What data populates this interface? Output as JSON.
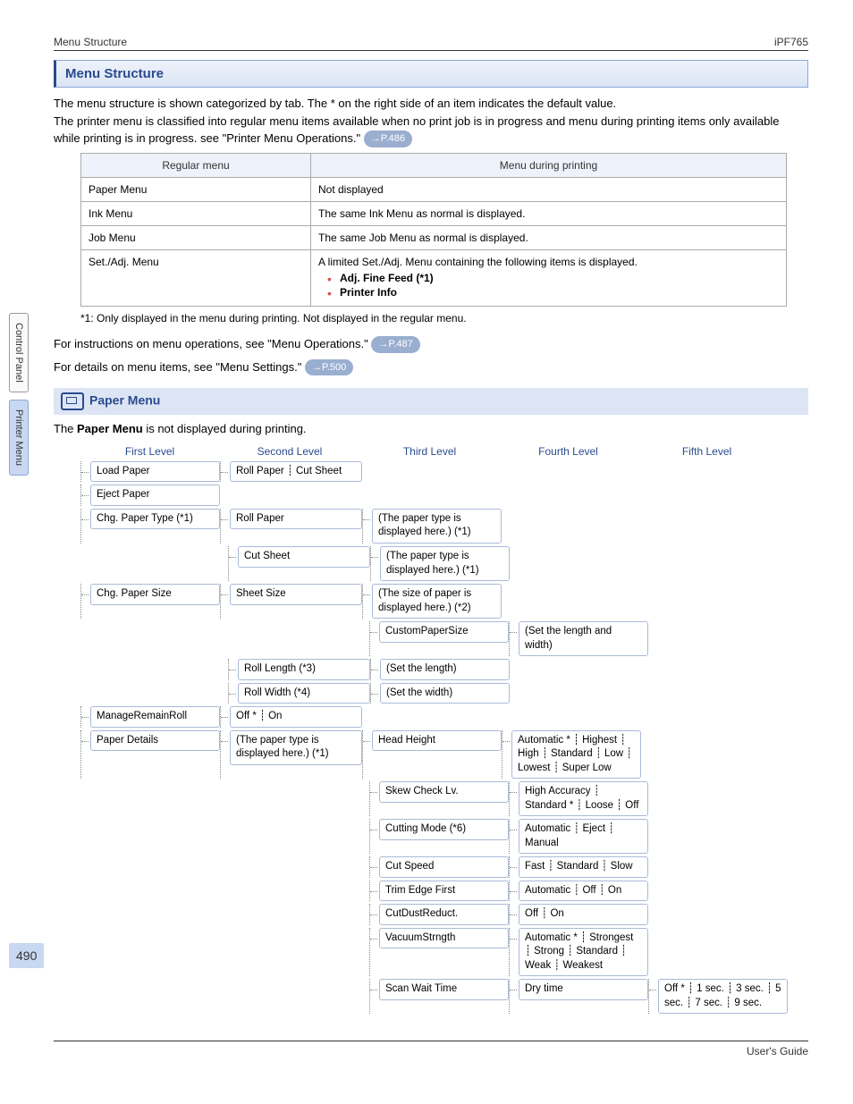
{
  "header": {
    "left": "Menu Structure",
    "right": "iPF765"
  },
  "sideTabs": {
    "tab1": "Control Panel",
    "tab2": "Printer Menu"
  },
  "pageNumber": "490",
  "section": {
    "title": "Menu Structure",
    "intro": "The menu structure is shown categorized by tab. The * on the right side of an item indicates the default value.\nThe printer menu is classified into regular menu items available when no print job is in progress and menu during printing items only available while printing is in progress. see \"Printer Menu Operations.\"",
    "introRef": "→P.486"
  },
  "table": {
    "th1": "Regular menu",
    "th2": "Menu during printing",
    "r1c1": "Paper Menu",
    "r1c2": "Not displayed",
    "r2c1": "Ink Menu",
    "r2c2": "The same Ink Menu as normal is displayed.",
    "r3c1": "Job Menu",
    "r3c2": "The same Job Menu as normal is displayed.",
    "r4c1": "Set./Adj. Menu",
    "r4c2": "A limited Set./Adj. Menu containing the following items is displayed.",
    "r4b1": "Adj. Fine Feed (*1)",
    "r4b2": "Printer Info"
  },
  "footnote1": "*1: Only displayed in the menu during printing. Not displayed in the regular menu.",
  "instr1a": "For instructions on menu operations, see \"Menu Operations.\"",
  "instr1ref": "→P.487",
  "instr2a": "For details on menu items, see \"Menu Settings.\"",
  "instr2ref": "→P.500",
  "paperMenu": {
    "title": "Paper Menu",
    "note": "The Paper Menu is not displayed during printing.",
    "noteStrong": "Paper Menu"
  },
  "levels": {
    "l1": "First Level",
    "l2": "Second Level",
    "l3": "Third Level",
    "l4": "Fourth Level",
    "l5": "Fifth Level"
  },
  "tree": {
    "loadPaper": "Load Paper",
    "loadPaperOpt": "Roll Paper ┊ Cut Sheet",
    "ejectPaper": "Eject Paper",
    "chgPaperType": "Chg. Paper Type (*1)",
    "rollPaper": "Roll Paper",
    "paperTypeDisp": "(The paper type is displayed here.) (*1)",
    "cutSheet": "Cut Sheet",
    "chgPaperSize": "Chg. Paper Size",
    "sheetSize": "Sheet Size",
    "sizeDisp": "(The size of paper is displayed here.) (*2)",
    "customPaperSize": "CustomPaperSize",
    "setLW": "(Set the length and width)",
    "rollLength": "Roll Length (*3)",
    "setLength": "(Set the length)",
    "rollWidth": "Roll Width (*4)",
    "setWidth": "(Set the width)",
    "manageRemainRoll": "ManageRemainRoll",
    "offOn": "Off * ┊ On",
    "paperDetails": "Paper Details",
    "headHeight": "Head Height",
    "headHeightOpt": "Automatic * ┊ Highest ┊ High ┊ Standard ┊ Low ┊ Lowest ┊ Super Low",
    "skewCheck": "Skew Check Lv.",
    "skewOpt": "High Accuracy ┊ Standard * ┊ Loose ┊ Off",
    "cuttingMode": "Cutting Mode (*6)",
    "cuttingOpt": "Automatic ┊ Eject ┊ Manual",
    "cutSpeed": "Cut Speed",
    "cutSpeedOpt": "Fast ┊ Standard ┊ Slow",
    "trimEdge": "Trim Edge First",
    "trimOpt": "Automatic ┊ Off ┊ On",
    "cutDust": "CutDustReduct.",
    "cutDustOpt": "Off ┊ On",
    "vacuum": "VacuumStrngth",
    "vacuumOpt": "Automatic * ┊ Strongest ┊ Strong ┊ Standard ┊ Weak ┊ Weakest",
    "scanWait": "Scan Wait Time",
    "dryTime": "Dry time",
    "dryOpt": "Off * ┊ 1 sec. ┊ 3 sec. ┊ 5 sec. ┊ 7 sec. ┊ 9 sec."
  },
  "footer": "User's Guide"
}
